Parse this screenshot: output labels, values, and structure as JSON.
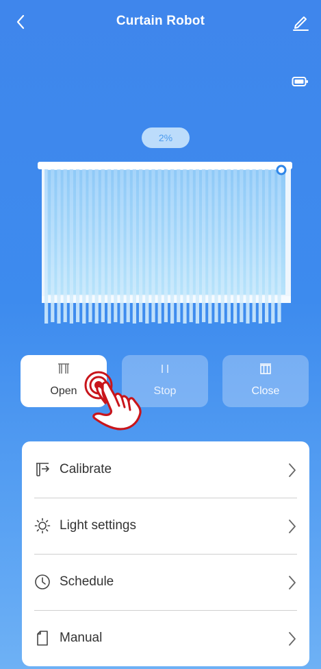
{
  "header": {
    "title": "Curtain Robot",
    "back_icon": "chevron-left-icon",
    "edit_icon": "pencil-icon"
  },
  "device": {
    "battery_icon": "battery-icon",
    "position_label": "2%",
    "position_value": 0.02
  },
  "controls": {
    "open_label": "Open",
    "stop_label": "Stop",
    "close_label": "Close",
    "selected": "Open"
  },
  "menu": {
    "items": [
      {
        "label": "Calibrate",
        "icon": "calibrate-icon"
      },
      {
        "label": "Light settings",
        "icon": "sun-icon"
      },
      {
        "label": "Schedule",
        "icon": "clock-icon"
      },
      {
        "label": "Manual",
        "icon": "document-icon"
      }
    ]
  },
  "colors": {
    "background_top": "#3f86ec",
    "background_bottom": "#6eb1f5",
    "badge_bg": "#bcdcfb",
    "badge_text": "#4a9aee",
    "hand_outline": "#c8151b"
  }
}
